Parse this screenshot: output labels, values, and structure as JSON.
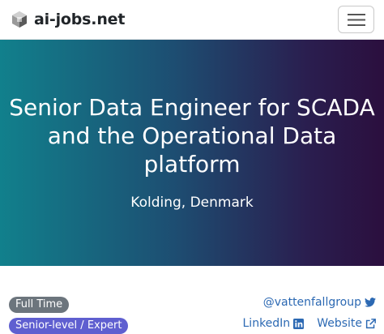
{
  "navbar": {
    "brand_name": "ai-jobs.net",
    "menu_toggle_icon": "hamburger-icon",
    "logo_icon": "ai-jobs-logo-icon"
  },
  "job": {
    "title": "Senior Data Engineer for SCADA and the Operational Data platform",
    "location": "Kolding, Denmark",
    "employment_type": "Full Time",
    "level": "Senior-level / Expert"
  },
  "company_links": {
    "twitter_handle": "@vattenfallgroup",
    "twitter_icon": "twitter-bird-icon",
    "linkedin_label": "LinkedIn",
    "linkedin_icon": "linkedin-icon",
    "website_label": "Website",
    "website_icon": "external-link-icon"
  },
  "colors": {
    "hero_gradient_start": "#11808c",
    "hero_gradient_end": "#2b0f3e",
    "link": "#2c69b3",
    "badge_type": "#6c757d",
    "badge_level": "#5f5fd0"
  }
}
